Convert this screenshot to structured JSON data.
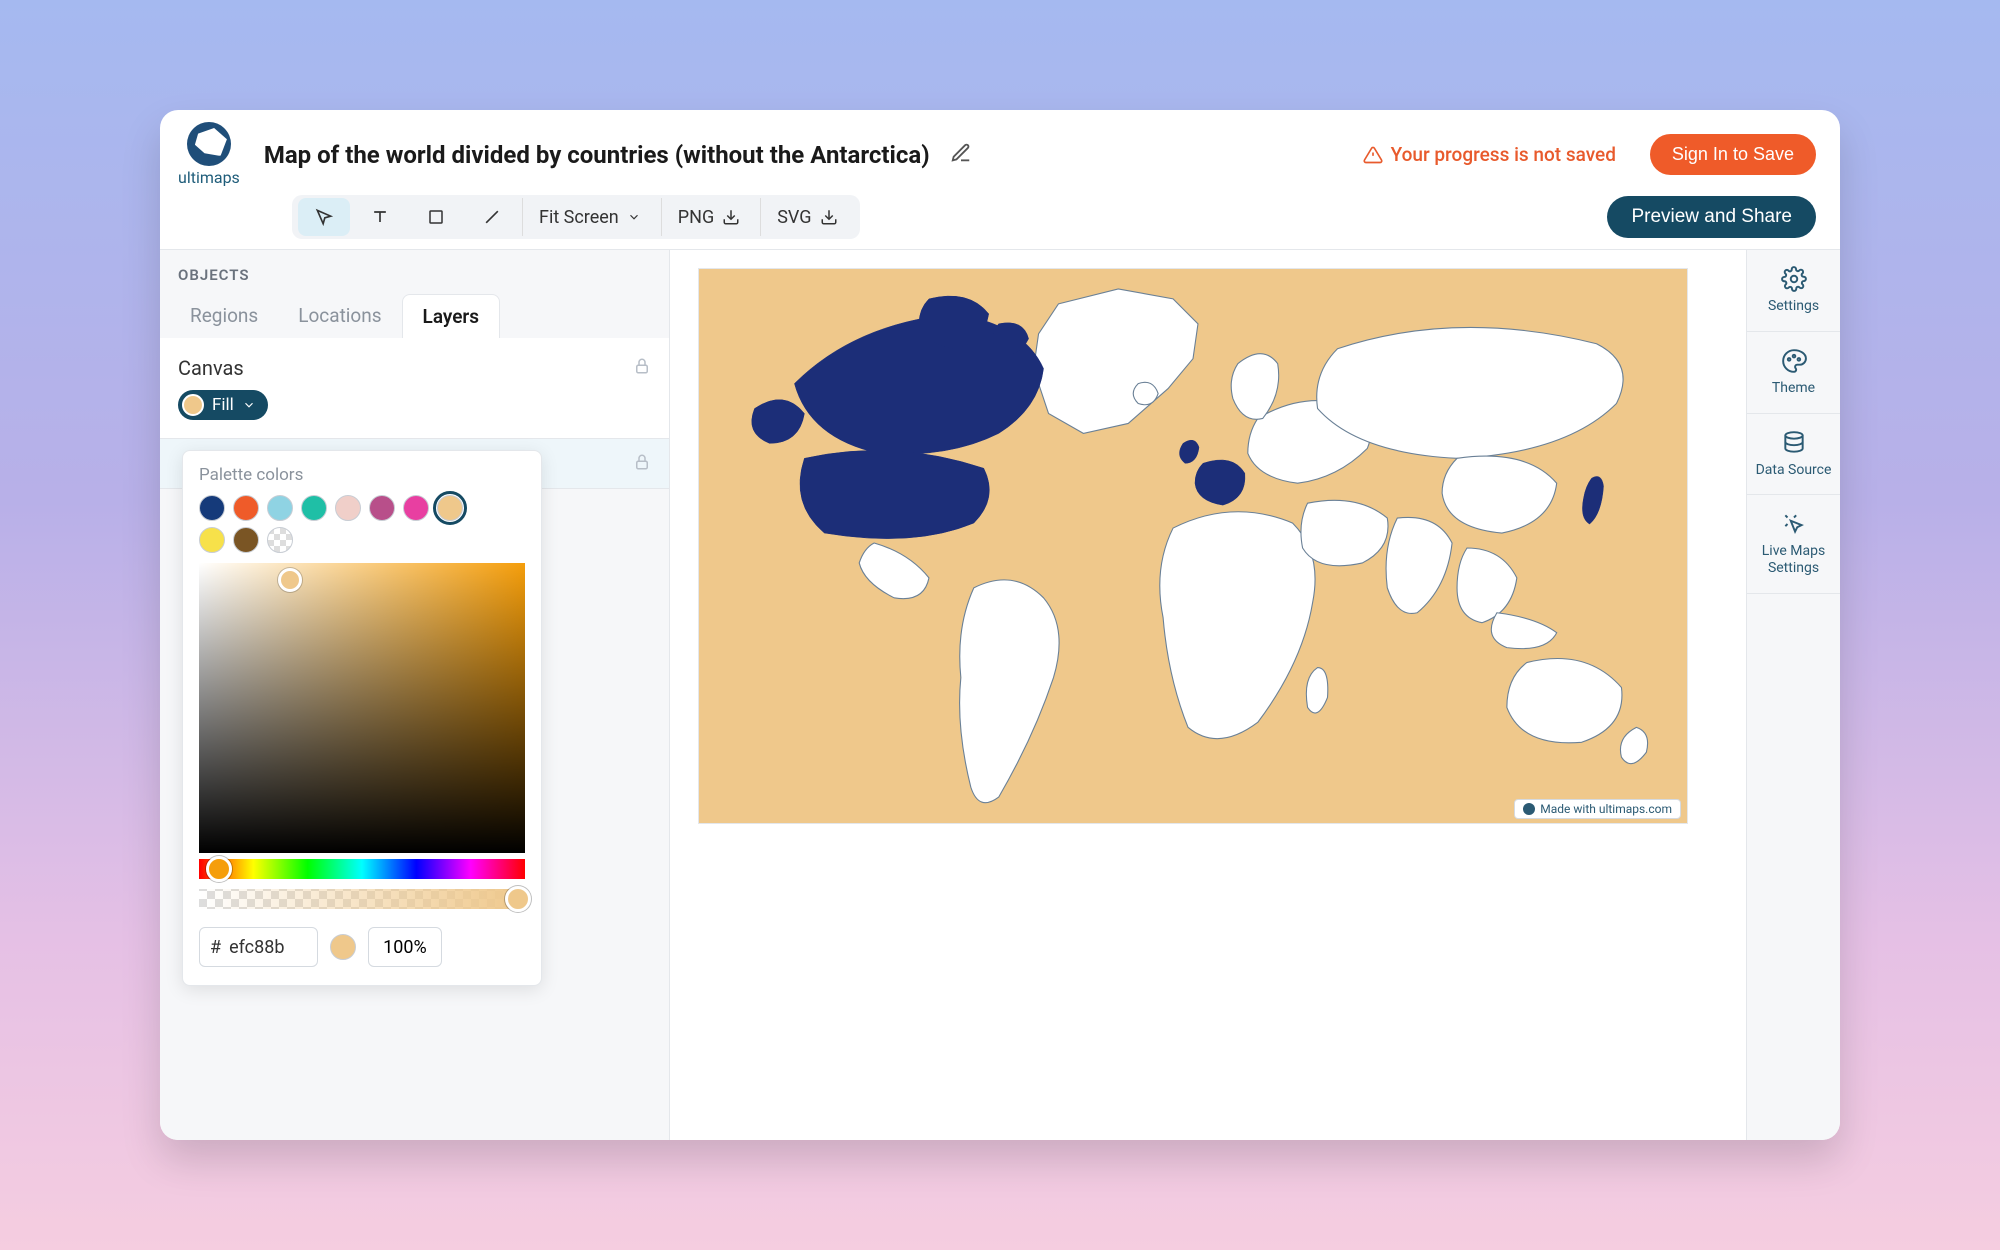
{
  "brand": "ultimaps",
  "title": "Map of the world divided by countries (without the Antarctica)",
  "warning_text": "Your progress is not saved",
  "signin_label": "Sign In to Save",
  "toolbar": {
    "zoom_label": "Fit Screen",
    "export_png": "PNG",
    "export_svg": "SVG",
    "preview_label": "Preview and Share"
  },
  "objects": {
    "header": "OBJECTS",
    "tabs": [
      "Regions",
      "Locations",
      "Layers"
    ],
    "active_tab": "Layers",
    "canvas_label": "Canvas",
    "fill_label": "Fill"
  },
  "picker": {
    "title": "Palette colors",
    "hex_prefix": "#",
    "hex_value": "efc88b",
    "opacity": "100%",
    "colors_row1": [
      "#153a7a",
      "#ef5b29",
      "#8fd3e3",
      "#1fbfa6",
      "#f0cfc9",
      "#b84f8a",
      "#e83fa1",
      "#efc88b"
    ],
    "colors_row2": [
      "#f7e14a",
      "#7a5524",
      "transparent"
    ],
    "selected_swatch": "#efc88b"
  },
  "map": {
    "bg": "#efc88b",
    "country_fill": "#ffffff",
    "country_stroke": "#6a8096",
    "highlight_fill": "#1c2e78",
    "attribution": "Made with ultimaps.com"
  },
  "rail": {
    "settings": "Settings",
    "theme": "Theme",
    "data": "Data Source",
    "live": "Live Maps Settings"
  }
}
